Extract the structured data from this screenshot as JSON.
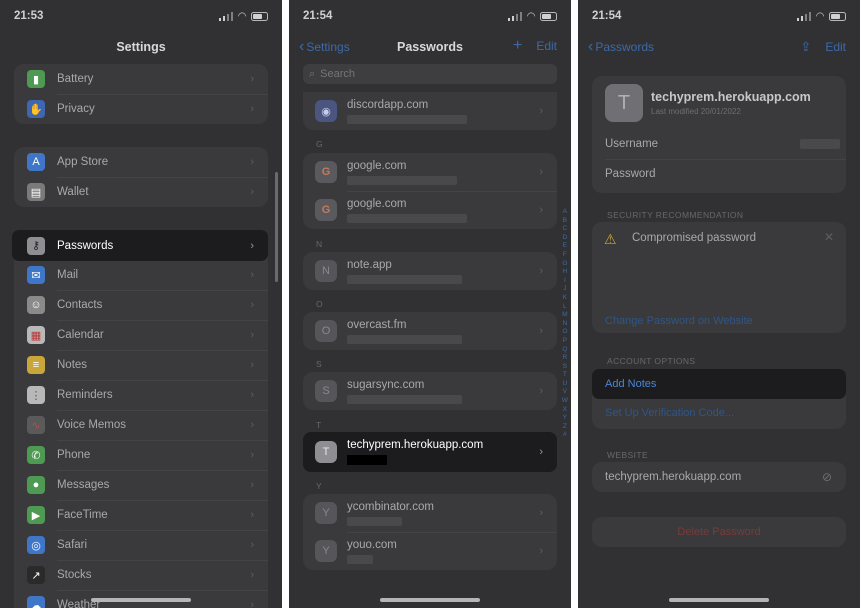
{
  "screen1": {
    "time": "21:53",
    "title": "Settings",
    "group_a": [
      {
        "label": "Battery",
        "icon": "battery-icon",
        "color": "#4f9a52"
      },
      {
        "label": "Privacy",
        "icon": "hand-icon",
        "color": "#3f66b3"
      }
    ],
    "group_b": [
      {
        "label": "App Store",
        "icon": "app-store-icon",
        "color": "#3f76c7"
      },
      {
        "label": "Wallet",
        "icon": "wallet-icon",
        "color": "#7a7a7a"
      }
    ],
    "highlight": {
      "label": "Passwords",
      "icon": "key-icon",
      "color": "#8e8e93"
    },
    "group_c": [
      {
        "label": "Mail",
        "icon": "mail-icon",
        "color": "#3f76c7"
      },
      {
        "label": "Contacts",
        "icon": "contacts-icon",
        "color": "#8a8a8a"
      },
      {
        "label": "Calendar",
        "icon": "calendar-icon",
        "color": "#b8b8b8"
      },
      {
        "label": "Notes",
        "icon": "notes-icon",
        "color": "#c9a63a"
      },
      {
        "label": "Reminders",
        "icon": "reminders-icon",
        "color": "#b8b8b8"
      },
      {
        "label": "Voice Memos",
        "icon": "voice-memos-icon",
        "color": "#5a5a5a"
      },
      {
        "label": "Phone",
        "icon": "phone-icon",
        "color": "#4f9a52"
      },
      {
        "label": "Messages",
        "icon": "messages-icon",
        "color": "#4f9a52"
      },
      {
        "label": "FaceTime",
        "icon": "facetime-icon",
        "color": "#4f9a52"
      },
      {
        "label": "Safari",
        "icon": "safari-icon",
        "color": "#3f76c7"
      },
      {
        "label": "Stocks",
        "icon": "stocks-icon",
        "color": "#2a2a2a"
      },
      {
        "label": "Weather",
        "icon": "weather-icon",
        "color": "#3f76c7"
      }
    ]
  },
  "screen2": {
    "time": "21:54",
    "back": "Settings",
    "title": "Passwords",
    "add": "+",
    "edit": "Edit",
    "search_placeholder": "Search",
    "sections": {
      "g": "G",
      "n": "N",
      "o": "O",
      "s": "S",
      "t": "T",
      "y": "Y"
    },
    "first": {
      "domain": "discordapp.com"
    },
    "g_items": [
      {
        "domain": "google.com",
        "letter": "G"
      },
      {
        "domain": "google.com",
        "letter": "G"
      }
    ],
    "n_item": {
      "domain": "note.app",
      "letter": "N"
    },
    "o_item": {
      "domain": "overcast.fm",
      "letter": "O"
    },
    "s_item": {
      "domain": "sugarsync.com",
      "letter": "S"
    },
    "t_item": {
      "domain": "techyprem.herokuapp.com",
      "letter": "T"
    },
    "y_items": [
      {
        "domain": "ycombinator.com",
        "letter": "Y"
      },
      {
        "domain": "youo.com",
        "letter": "Y"
      }
    ],
    "alphabet": [
      "A",
      "B",
      "C",
      "D",
      "E",
      "F",
      "G",
      "H",
      "I",
      "J",
      "K",
      "L",
      "M",
      "N",
      "O",
      "P",
      "Q",
      "R",
      "S",
      "T",
      "U",
      "V",
      "W",
      "X",
      "Y",
      "Z",
      "#"
    ]
  },
  "screen3": {
    "time": "21:54",
    "back": "Passwords",
    "edit": "Edit",
    "site_letter": "T",
    "site": "techyprem.herokuapp.com",
    "modified": "Last modified 20/01/2022",
    "username_label": "Username",
    "password_label": "Password",
    "security_header": "SECURITY RECOMMENDATION",
    "compromised": "Compromised password",
    "change_link": "Change Password on Website",
    "account_header": "ACCOUNT OPTIONS",
    "add_notes": "Add Notes",
    "setup_code": "Set Up Verification Code...",
    "website_header": "WEBSITE",
    "website": "techyprem.herokuapp.com",
    "delete": "Delete Password"
  }
}
